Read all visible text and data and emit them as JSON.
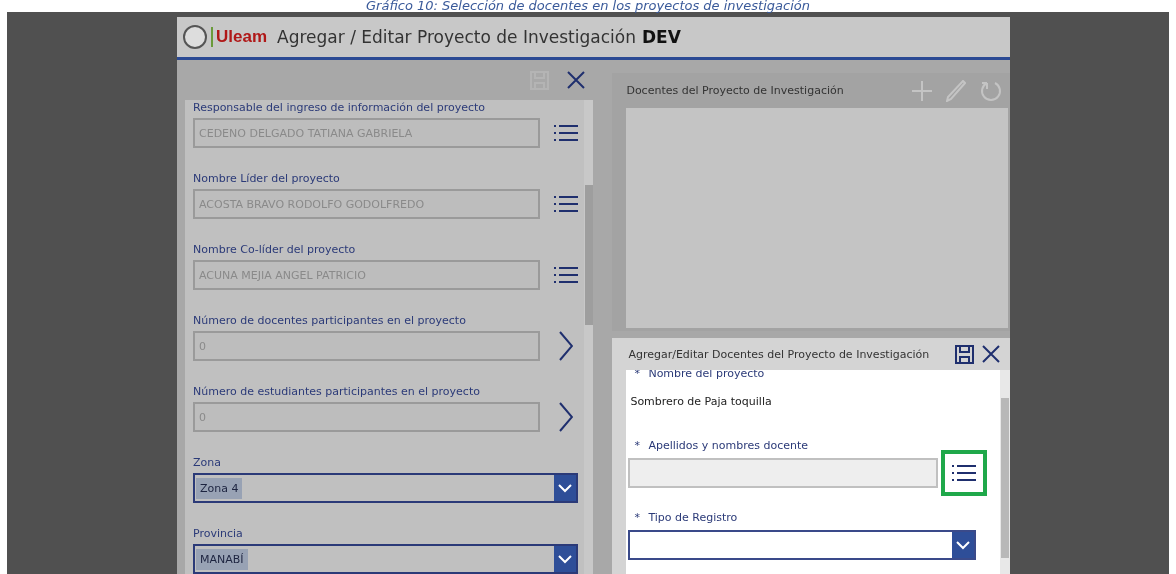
{
  "caption": "Gráfico 10: Selección de docentes en los  proyectos de investigación",
  "app": {
    "logo_text": "Uleam",
    "title": "Agregar / Editar Proyecto de Investigación",
    "environment": "DEV"
  },
  "project_form": {
    "save_disabled": true,
    "fields": [
      {
        "kind": "lookup",
        "label": "Responsable del ingreso de información del proyecto",
        "value": "CEDENO DELGADO TATIANA GABRIELA"
      },
      {
        "kind": "lookup",
        "label": "Nombre Líder del proyecto",
        "value": "ACOSTA BRAVO RODOLFO GODOLFREDO"
      },
      {
        "kind": "lookup",
        "label": "Nombre Co-líder del proyecto",
        "value": "ACUNA MEJIA ANGEL PATRICIO"
      },
      {
        "kind": "counter",
        "label": "Número de docentes participantes en el proyecto",
        "value": "0"
      },
      {
        "kind": "counter",
        "label": "Número de estudiantes participantes en el proyecto",
        "value": "0"
      },
      {
        "kind": "dropdown",
        "label": "Zona",
        "value": "Zona 4"
      },
      {
        "kind": "dropdown",
        "label": "Provincia",
        "value": "MANABÍ"
      }
    ]
  },
  "docentes_panel": {
    "title": "Docentes del Proyecto de Investigación",
    "tools_disabled": true
  },
  "docente_dialog": {
    "title": "Agregar/Editar Docentes del Proyecto de Investigación",
    "save_disabled": false,
    "fields": [
      {
        "kind": "readonly",
        "required_mark": "*",
        "label": "Nombre del proyecto",
        "value": "Sombrero de Paja toquilla"
      },
      {
        "kind": "lookup",
        "required_mark": "*",
        "label": "Apellidos y nombres docente",
        "highlighted": true
      },
      {
        "kind": "dropdown",
        "required_mark": "*",
        "label": "Tipo de Registro"
      }
    ]
  }
}
